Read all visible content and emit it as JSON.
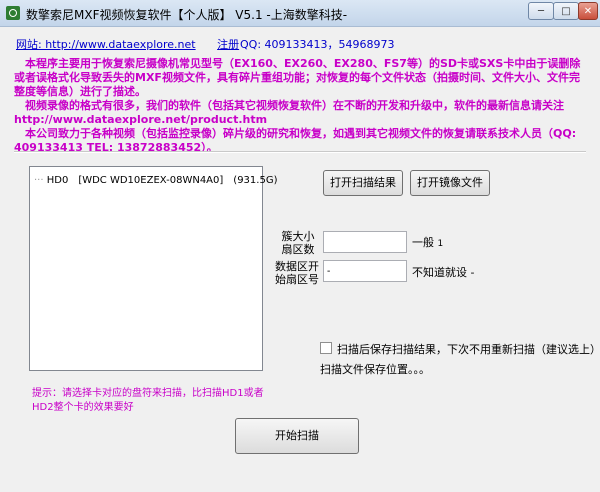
{
  "window": {
    "title": "数擎索尼MXF视频恢复软件【个人版】 V5.1 -上海数擎科技-",
    "min_label": "─",
    "max_label": "□",
    "close_label": "✕"
  },
  "links": {
    "website_label": "网站: http://www.dataexplore.net",
    "register_label": "注册",
    "qq_label": "QQ: 409133413，54968973"
  },
  "description": {
    "p1": "　本程序主要用于恢复索尼摄像机常见型号（EX160、EX260、EX280、FS7等）的SD卡或SXS卡中由于误删除或者误格式化导致丢失的MXF视频文件，具有碎片重组功能；对恢复的每个文件状态（拍摄时间、文件大小、文件完整度等信息）进行了描述。",
    "p2": "　视频录像的格式有很多，我们的软件（包括其它视频恢复软件）在不断的开发和升级中，软件的最新信息请关注 http://www.dataexplore.net/product.htm",
    "p3": "　本公司致力于各种视频（包括监控录像）碎片级的研究和恢复，如遇到其它视频文件的恢复请联系技术人员（QQ: 409133413  TEL: 13872883452）。"
  },
  "tree": {
    "items": [
      {
        "label": "HD0　[WDC WD10EZEX-08WN4A0]　(931.5G)"
      }
    ]
  },
  "buttons": {
    "open_scan_result": "打开扫描结果",
    "open_image_file": "打开镜像文件",
    "start_scan": "开始扫描"
  },
  "form": {
    "cluster_label": "簇大小\n扇区数",
    "cluster_value": "",
    "cluster_hint": "一般",
    "cluster_hint_num": "1",
    "data_start_label": "数据区开\n始扇区号",
    "data_start_value": "-",
    "data_start_hint": "不知道就设 -"
  },
  "options": {
    "save_after_scan_checked": false,
    "save_after_scan_label": "扫描后保存扫描结果，下次不用重新扫描（建议选上）",
    "save_location_label": "扫描文件保存位置。。。"
  },
  "tip": {
    "text": "提示：请选择卡对应的盘符来扫描，比扫描HD1或者HD2整个卡的效果要好"
  },
  "colors": {
    "description_text": "#c800c8",
    "link_text": "#0000cc"
  }
}
